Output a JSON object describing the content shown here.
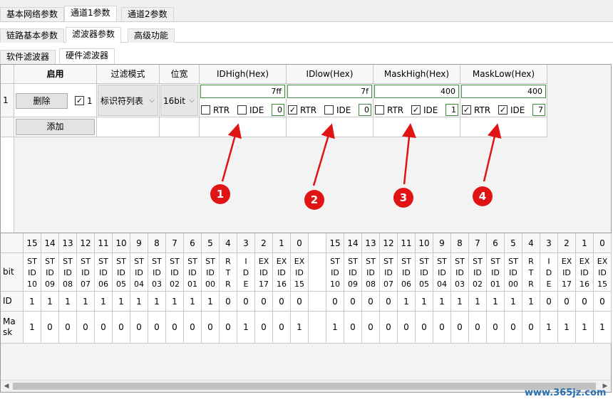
{
  "tabs_level1": [
    "基本网络参数",
    "通道1参数",
    "通道2参数"
  ],
  "tabs_level2": [
    "链路基本参数",
    "滤波器参数",
    "高级功能"
  ],
  "tabs_level3": [
    "软件滤波器",
    "硬件滤波器"
  ],
  "filter_table": {
    "headers": [
      "启用",
      "过滤模式",
      "位宽",
      "IDHigh(Hex)",
      "IDlow(Hex)",
      "MaskHigh(Hex)",
      "MaskLow(Hex)"
    ],
    "row": {
      "index": "1",
      "delete_label": "删除",
      "enable_checked": true,
      "enable_value": "1",
      "mode": "标识符列表",
      "width": "16bit",
      "filters": [
        {
          "hex": "7ff",
          "rtr_label": "RTR",
          "rtr": false,
          "ide_label": "IDE",
          "ide": false,
          "num": "0"
        },
        {
          "hex": "7f",
          "rtr_label": "RTR",
          "rtr": true,
          "ide_label": "IDE",
          "ide": false,
          "num": "0"
        },
        {
          "hex": "400",
          "rtr_label": "RTR",
          "rtr": false,
          "ide_label": "IDE",
          "ide": true,
          "num": "1"
        },
        {
          "hex": "400",
          "rtr_label": "RTR",
          "rtr": true,
          "ide_label": "IDE",
          "ide": true,
          "num": "7"
        }
      ]
    },
    "add_label": "添加"
  },
  "markers": [
    "1",
    "2",
    "3",
    "4"
  ],
  "annotation_color": "#e01414",
  "bit_table": {
    "row_labels": [
      "bit",
      "ID",
      "Ma\nsk"
    ],
    "groups": [
      {
        "bits": [
          "15",
          "14",
          "13",
          "12",
          "11",
          "10",
          "9",
          "8",
          "7",
          "6",
          "5",
          "4",
          "3",
          "2",
          "1",
          "0"
        ],
        "names": [
          "ST\nID\n10",
          "ST\nID\n09",
          "ST\nID\n08",
          "ST\nID\n07",
          "ST\nID\n06",
          "ST\nID\n05",
          "ST\nID\n04",
          "ST\nID\n03",
          "ST\nID\n02",
          "ST\nID\n01",
          "ST\nID\n00",
          "R\nT\nR",
          "I\nD\nE",
          "EX\nID\n17",
          "EX\nID\n16",
          "EX\nID\n15"
        ],
        "id": [
          "1",
          "1",
          "1",
          "1",
          "1",
          "1",
          "1",
          "1",
          "1",
          "1",
          "1",
          "0",
          "0",
          "0",
          "0",
          "0"
        ],
        "mask": [
          "1",
          "0",
          "0",
          "0",
          "0",
          "0",
          "0",
          "0",
          "0",
          "0",
          "0",
          "0",
          "1",
          "0",
          "0",
          "1"
        ]
      },
      {
        "bits": [
          "15",
          "14",
          "13",
          "12",
          "11",
          "10",
          "9",
          "8",
          "7",
          "6",
          "5",
          "4",
          "3",
          "2",
          "1",
          "0"
        ],
        "names": [
          "ST\nID\n10",
          "ST\nID\n09",
          "ST\nID\n08",
          "ST\nID\n07",
          "ST\nID\n06",
          "ST\nID\n05",
          "ST\nID\n04",
          "ST\nID\n03",
          "ST\nID\n02",
          "ST\nID\n01",
          "ST\nID\n00",
          "R\nT\nR",
          "I\nD\nE",
          "EX\nID\n17",
          "EX\nID\n16",
          "EX\nID\n15"
        ],
        "id": [
          "0",
          "0",
          "0",
          "0",
          "1",
          "1",
          "1",
          "1",
          "1",
          "1",
          "1",
          "1",
          "0",
          "0",
          "0",
          "0"
        ],
        "mask": [
          "1",
          "0",
          "0",
          "0",
          "0",
          "0",
          "0",
          "0",
          "0",
          "0",
          "0",
          "0",
          "1",
          "1",
          "1",
          "1"
        ]
      }
    ]
  },
  "watermark": "www.365jz.com"
}
